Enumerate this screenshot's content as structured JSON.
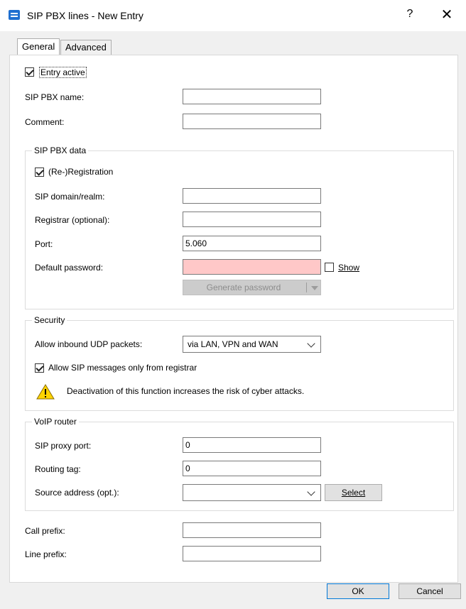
{
  "window": {
    "title": "SIP PBX lines - New Entry",
    "help": "?",
    "close": "✕"
  },
  "tabs": [
    {
      "label": "General",
      "active": true
    },
    {
      "label": "Advanced",
      "active": false
    }
  ],
  "general": {
    "entry_active": {
      "label": "Entry active",
      "checked": true
    },
    "sip_pbx_name": {
      "label": "SIP PBX name:",
      "value": ""
    },
    "comment": {
      "label": "Comment:",
      "value": ""
    }
  },
  "sip_pbx_data": {
    "title": "SIP PBX data",
    "registration": {
      "label": "(Re-)Registration",
      "checked": true
    },
    "domain": {
      "label": "SIP domain/realm:",
      "value": ""
    },
    "registrar": {
      "label": "Registrar (optional):",
      "value": ""
    },
    "port": {
      "label": "Port:",
      "value": "5.060"
    },
    "default_password": {
      "label": "Default password:",
      "value": ""
    },
    "show": {
      "label": "Show",
      "checked": false
    },
    "generate": {
      "label": "Generate password"
    }
  },
  "security": {
    "title": "Security",
    "udp_label": "Allow inbound UDP packets:",
    "udp_value": "via LAN, VPN and WAN",
    "registrar_only": {
      "label": "Allow SIP messages only from registrar",
      "checked": true
    },
    "warning": "Deactivation of this function increases the risk of cyber attacks."
  },
  "voip_router": {
    "title": "VoIP router",
    "proxy_port": {
      "label": "SIP proxy port:",
      "value": "0"
    },
    "routing_tag": {
      "label": "Routing tag:",
      "value": "0"
    },
    "source_address": {
      "label": "Source address (opt.):",
      "value": ""
    },
    "select": "Select"
  },
  "prefixes": {
    "call_prefix": {
      "label": "Call prefix:",
      "value": ""
    },
    "line_prefix": {
      "label": "Line prefix:",
      "value": ""
    }
  },
  "footer": {
    "ok": "OK",
    "cancel": "Cancel"
  },
  "colors": {
    "accent": "#0078d7",
    "password_invalid": "#ffc8c8",
    "warning": "#ffd400"
  }
}
